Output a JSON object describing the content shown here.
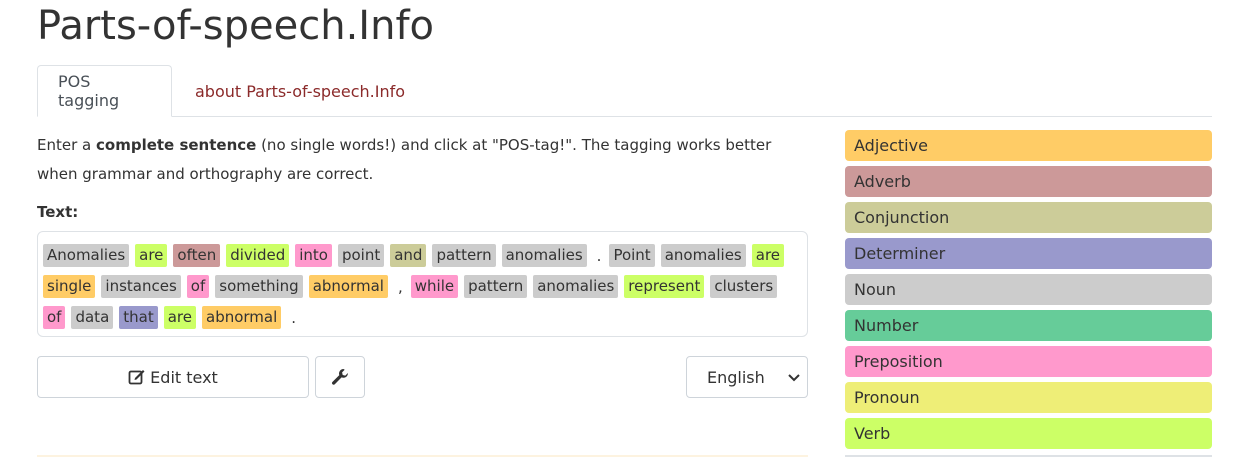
{
  "site": {
    "title": "Parts-of-speech.Info"
  },
  "tabs": [
    {
      "label": "POS tagging",
      "active": true
    },
    {
      "label": "about Parts-of-speech.Info",
      "active": false
    }
  ],
  "intro": {
    "part1": "Enter a ",
    "bold": "complete sentence",
    "part2": " (no single words!) and click at \"POS-tag!\". The tagging works better when grammar and orthography are correct."
  },
  "text_label": "Text:",
  "tagged_lines": [
    [
      {
        "w": "Anomalies",
        "pos": "noun"
      },
      {
        "w": "are",
        "pos": "verb"
      },
      {
        "w": "often",
        "pos": "adv"
      },
      {
        "w": "divided",
        "pos": "verb"
      },
      {
        "w": "into",
        "pos": "prep"
      },
      {
        "w": "point",
        "pos": "noun"
      },
      {
        "w": "and",
        "pos": "conj"
      },
      {
        "w": "pattern",
        "pos": "noun"
      },
      {
        "w": "anomalies",
        "pos": "noun"
      },
      {
        "w": ".",
        "pos": "punct"
      },
      {
        "w": "Point",
        "pos": "noun"
      },
      {
        "w": "anomalies",
        "pos": "noun"
      },
      {
        "w": "are",
        "pos": "verb"
      }
    ],
    [
      {
        "w": "single",
        "pos": "adj"
      },
      {
        "w": "instances",
        "pos": "noun"
      },
      {
        "w": "of",
        "pos": "prep"
      },
      {
        "w": "something",
        "pos": "noun"
      },
      {
        "w": "abnormal",
        "pos": "adj"
      },
      {
        "w": ",",
        "pos": "punct"
      },
      {
        "w": "while",
        "pos": "prep"
      },
      {
        "w": "pattern",
        "pos": "noun"
      },
      {
        "w": "anomalies",
        "pos": "noun"
      },
      {
        "w": "represent",
        "pos": "verb"
      },
      {
        "w": "clusters",
        "pos": "noun"
      }
    ],
    [
      {
        "w": "of",
        "pos": "prep"
      },
      {
        "w": "data",
        "pos": "noun"
      },
      {
        "w": "that",
        "pos": "det"
      },
      {
        "w": "are",
        "pos": "verb"
      },
      {
        "w": "abnormal",
        "pos": "adj"
      },
      {
        "w": ".",
        "pos": "punct"
      }
    ]
  ],
  "buttons": {
    "edit_label": "Edit text",
    "edit_icon": "edit-icon",
    "tool_icon": "wrench-icon"
  },
  "language": {
    "selected": "English"
  },
  "legend": [
    {
      "label": "Adjective",
      "pos": "adj",
      "color": "#ffcc66"
    },
    {
      "label": "Adverb",
      "pos": "adv",
      "color": "#cc9999"
    },
    {
      "label": "Conjunction",
      "pos": "conj",
      "color": "#cccc99"
    },
    {
      "label": "Determiner",
      "pos": "det",
      "color": "#9999cc"
    },
    {
      "label": "Noun",
      "pos": "noun",
      "color": "#cccccc"
    },
    {
      "label": "Number",
      "pos": "num",
      "color": "#66cc99"
    },
    {
      "label": "Preposition",
      "pos": "prep",
      "color": "#ff99cc"
    },
    {
      "label": "Pronoun",
      "pos": "pron",
      "color": "#eeee77"
    },
    {
      "label": "Verb",
      "pos": "verb",
      "color": "#ccff66"
    }
  ]
}
